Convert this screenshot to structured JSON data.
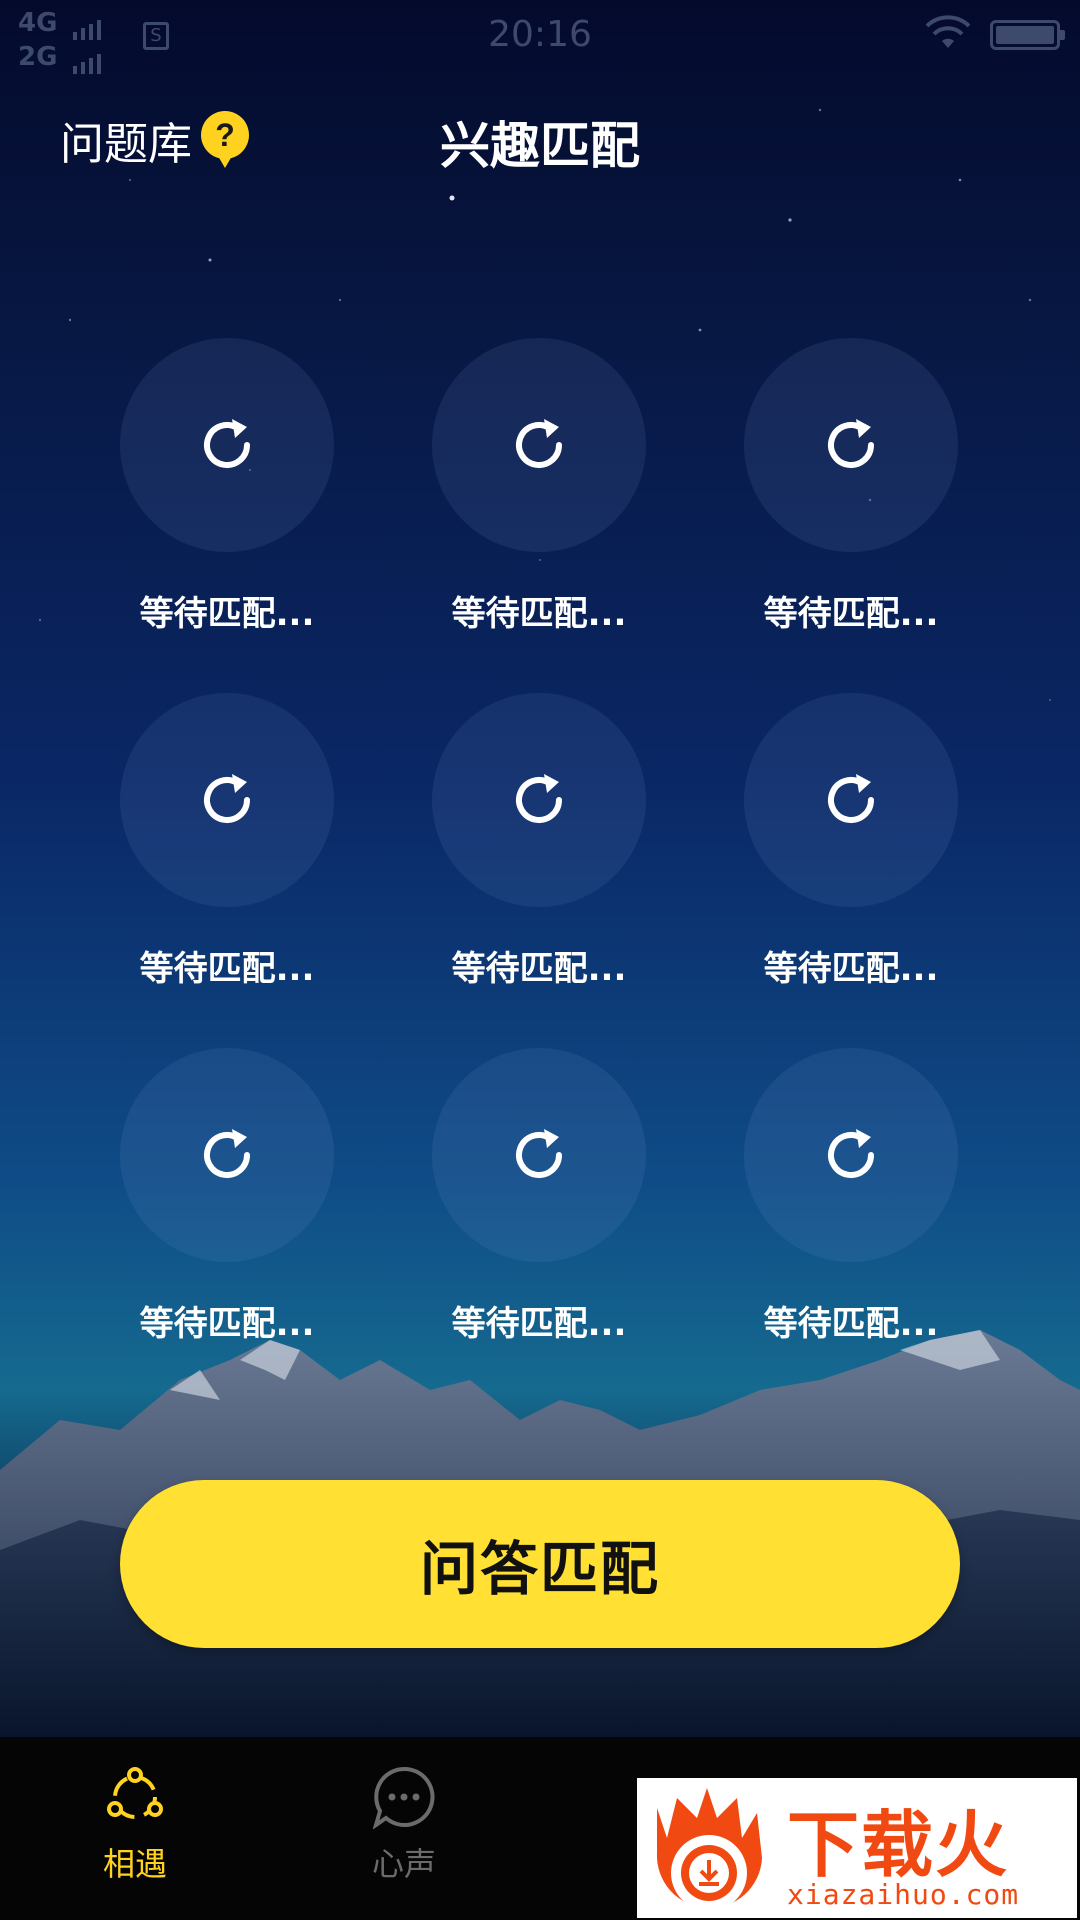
{
  "status_bar": {
    "network_top": "4G",
    "network_bottom": "2G",
    "sim_label": "S",
    "time": "20:16"
  },
  "header": {
    "question_bank_label": "问题库",
    "help_icon": "question-bubble-icon",
    "title": "兴趣匹配"
  },
  "match_slots": [
    {
      "label": "等待匹配...",
      "icon": "refresh-icon"
    },
    {
      "label": "等待匹配...",
      "icon": "refresh-icon"
    },
    {
      "label": "等待匹配...",
      "icon": "refresh-icon"
    },
    {
      "label": "等待匹配...",
      "icon": "refresh-icon"
    },
    {
      "label": "等待匹配...",
      "icon": "refresh-icon"
    },
    {
      "label": "等待匹配...",
      "icon": "refresh-icon"
    },
    {
      "label": "等待匹配...",
      "icon": "refresh-icon"
    },
    {
      "label": "等待匹配...",
      "icon": "refresh-icon"
    },
    {
      "label": "等待匹配...",
      "icon": "refresh-icon"
    }
  ],
  "cta": {
    "label": "问答匹配"
  },
  "bottom_nav": {
    "items": [
      {
        "label": "相遇",
        "icon": "encounter-icon",
        "active": true
      },
      {
        "label": "心声",
        "icon": "chat-bubble-icon",
        "active": false
      }
    ]
  },
  "watermark": {
    "text": "下载火",
    "url": "xiazaihuo.com"
  },
  "colors": {
    "accent_yellow": "#ffe033",
    "nav_active": "#ffd21f",
    "nav_inactive": "#6b6b6b"
  }
}
